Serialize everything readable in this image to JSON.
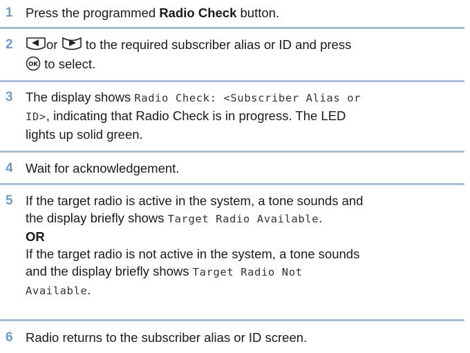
{
  "steps": [
    {
      "num": "1",
      "pre": "Press the programmed ",
      "bold": "Radio Check",
      "post": " button."
    },
    {
      "num": "2",
      "mid": "or",
      "post": " to the required subscriber alias or ID and press",
      "line2": " to select.",
      "icons": {
        "left_key": "left-arrow-key-icon",
        "right_key": "right-arrow-key-icon",
        "ok_key": "ok-key-icon"
      }
    },
    {
      "num": "3",
      "pre": "The display shows ",
      "mono": "Radio Check: <Subscriber Alias or",
      "mono2": "ID>",
      "post": ", indicating that Radio Check is in progress. The LED",
      "line3": "lights up solid green."
    },
    {
      "num": "4",
      "text": "Wait for acknowledgement."
    },
    {
      "num": "5",
      "l1": "If the target radio is active in the system, a tone sounds and",
      "l2": "the display briefly shows ",
      "l2mono": "Target Radio Available",
      "l2end": ".",
      "or": "OR",
      "l4": "If the target radio is not active in the system, a tone sounds",
      "l5": "and the display briefly shows ",
      "l5mono": "Target Radio Not",
      "l6mono": "Available",
      "l6end": "."
    },
    {
      "num": "6",
      "text": "Radio returns to the subscriber alias or ID screen."
    }
  ],
  "colors": {
    "number": "#6e9bc1",
    "rule": "#a7bfd6"
  }
}
